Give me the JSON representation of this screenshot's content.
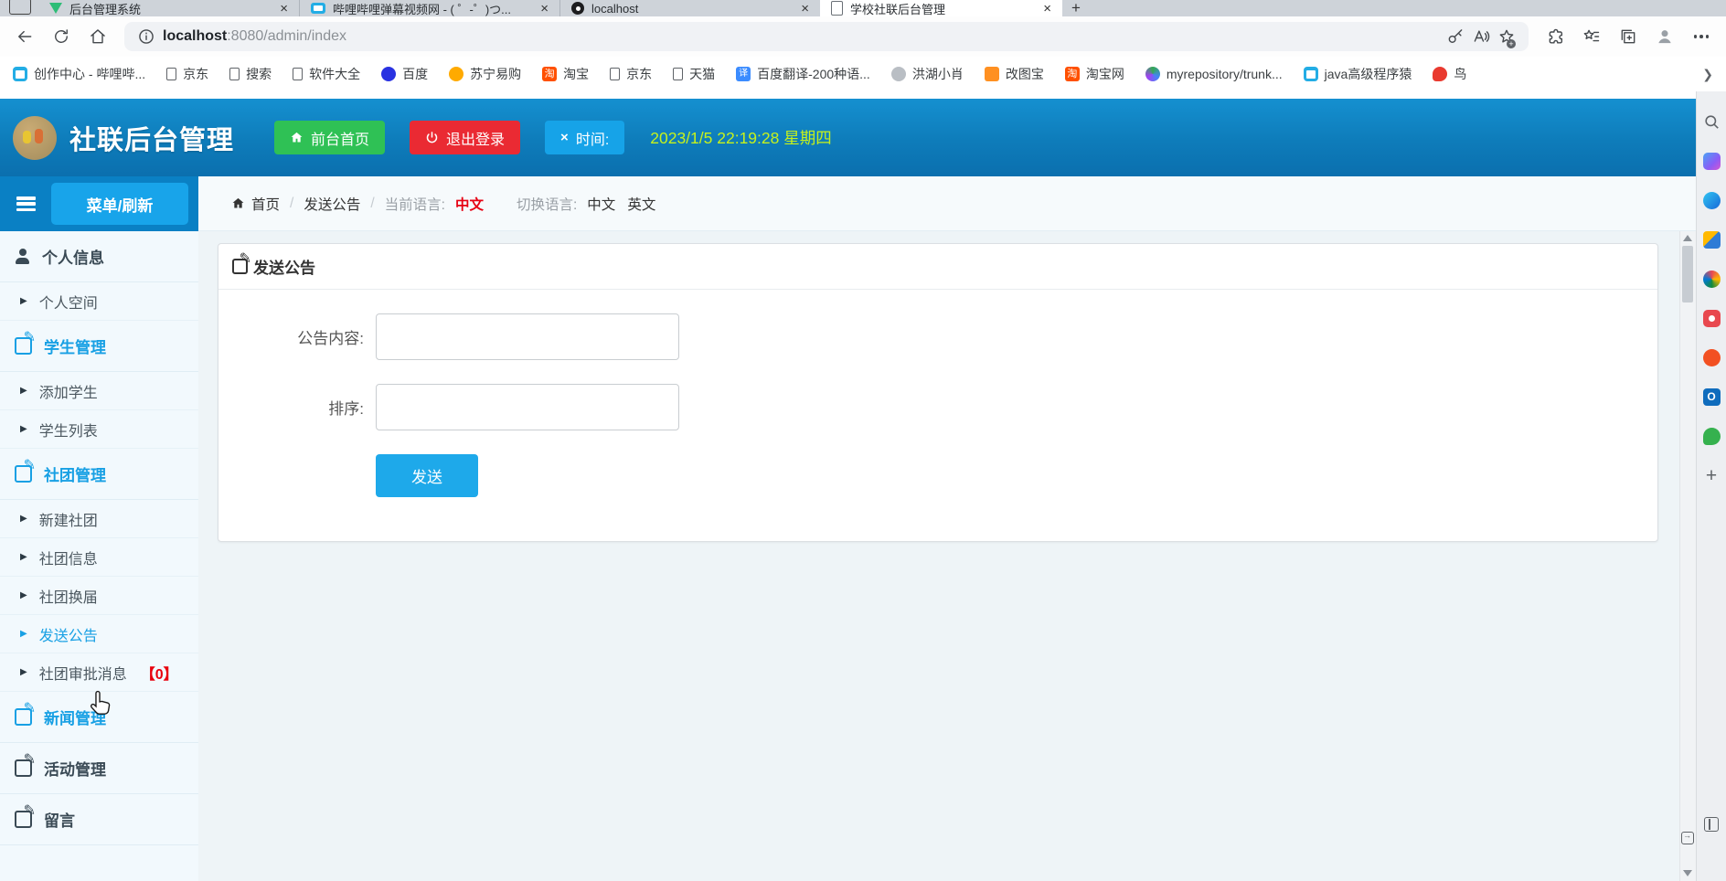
{
  "browser": {
    "tabs": [
      {
        "title": "后台管理系统"
      },
      {
        "title": "哔哩哔哩弹幕视频网 - ( ゜-゜)つ..."
      },
      {
        "title": "localhost"
      },
      {
        "title": "学校社联后台管理"
      }
    ],
    "url_host": "localhost",
    "url_path": ":8080/admin/index",
    "bookmarks": [
      "创作中心 - 哔哩哔...",
      "京东",
      "搜索",
      "软件大全",
      "百度",
      "苏宁易购",
      "淘宝",
      "京东",
      "天猫",
      "百度翻译-200种语...",
      "洪湖小肖",
      "改图宝",
      "淘宝网",
      "myrepository/trunk...",
      "java高级程序猿",
      "鸟"
    ],
    "toolbar_icons": [
      "back-icon",
      "refresh-icon",
      "home-icon",
      "site-info-icon",
      "password-key-icon",
      "read-aloud-icon",
      "add-favorite-icon",
      "extensions-icon",
      "favorites-hub-icon",
      "collections-icon",
      "profile-avatar",
      "settings-menu-icon"
    ],
    "edge_sidebar_icons": [
      "search-icon",
      "copilot-icon",
      "shopping-icon",
      "microsoft365-icon",
      "games-icon",
      "favorites-red-icon",
      "essentials-icon",
      "outlook-icon",
      "drop-icon",
      "add-app-icon",
      "sidebar-toggle-icon"
    ]
  },
  "app": {
    "title": "社联后台管理",
    "front_home_btn": "前台首页",
    "logout_btn": "退出登录",
    "time_btn": "时间:",
    "time_text": "2023/1/5 22:19:28 星期四",
    "menu_refresh_btn": "菜单/刷新"
  },
  "menu": {
    "items": [
      {
        "label": "个人信息"
      },
      {
        "label": "个人空间"
      },
      {
        "label": "学生管理"
      },
      {
        "label": "添加学生"
      },
      {
        "label": "学生列表"
      },
      {
        "label": "社团管理"
      },
      {
        "label": "新建社团"
      },
      {
        "label": "社团信息"
      },
      {
        "label": "社团换届"
      },
      {
        "label": "发送公告"
      },
      {
        "label": "社团审批消息",
        "badge": "【0】"
      },
      {
        "label": "新闻管理"
      },
      {
        "label": "活动管理"
      },
      {
        "label": "留言"
      }
    ]
  },
  "breadcrumb": {
    "home": "首页",
    "current": "发送公告",
    "lang_label": "当前语言:",
    "lang_value": "中文",
    "switch_label": "切换语言:",
    "zh": "中文",
    "en": "英文"
  },
  "panel": {
    "title": "发送公告",
    "content_label": "公告内容:",
    "sort_label": "排序:",
    "send_btn": "发送"
  },
  "colors": {
    "accent_blue": "#18a4ea",
    "header_blue": "#0e7cba",
    "green_btn": "#2fc155",
    "red_btn": "#ea2a33",
    "time_text": "#c6f11c",
    "lang_red": "#e60012",
    "badge_red": "#e8000d"
  }
}
